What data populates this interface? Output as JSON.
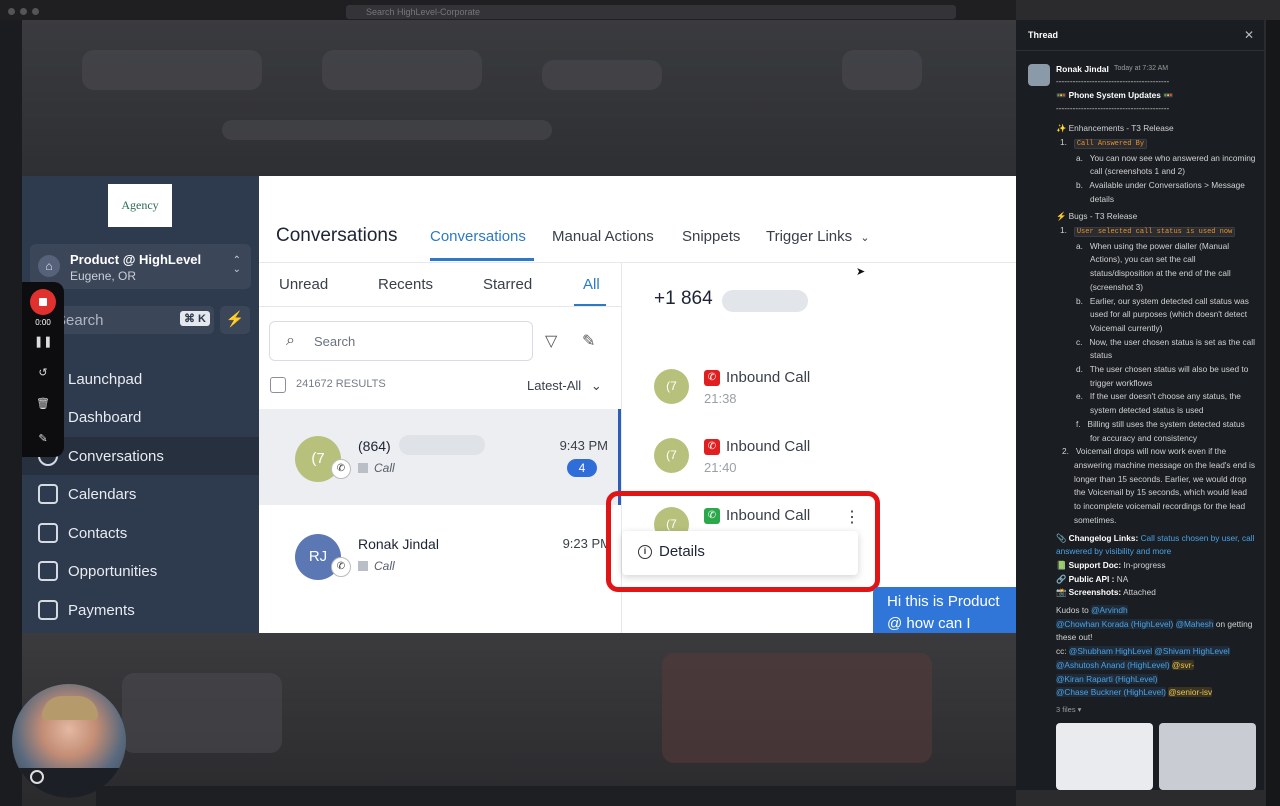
{
  "browser": {
    "search_placeholder": "Search HighLevel-Corporate"
  },
  "logo_text": "Agency",
  "account": {
    "name": "Product @ HighLevel",
    "location": "Eugene, OR"
  },
  "sidebar": {
    "search_placeholder": "Search",
    "shortcut": "⌘ K",
    "items": [
      {
        "label": "Launchpad",
        "icon": "rocket-icon"
      },
      {
        "label": "Dashboard",
        "icon": "grid-icon"
      },
      {
        "label": "Conversations",
        "icon": "chat-icon"
      },
      {
        "label": "Calendars",
        "icon": "calendar-icon"
      },
      {
        "label": "Contacts",
        "icon": "contact-icon"
      },
      {
        "label": "Opportunities",
        "icon": "funnel-icon"
      },
      {
        "label": "Payments",
        "icon": "payment-icon"
      }
    ]
  },
  "recorder": {
    "time": "0:00"
  },
  "header": {
    "title": "Conversations",
    "tabs": [
      "Conversations",
      "Manual Actions",
      "Snippets",
      "Trigger Links"
    ]
  },
  "list": {
    "sub_tabs": [
      "Unread",
      "Recents",
      "Starred",
      "All"
    ],
    "search_placeholder": "Search",
    "results": "241672 RESULTS",
    "sort": "Latest-All",
    "rows": [
      {
        "initials": "(7",
        "name": "(864)",
        "type": "Call",
        "time": "9:43 PM",
        "count": "4",
        "color": "#b8c17c"
      },
      {
        "initials": "RJ",
        "name": "Ronak Jindal",
        "type": "Call",
        "time": "9:23 PM",
        "color": "#5b78b5"
      }
    ]
  },
  "chat": {
    "phone": "+1 864",
    "calls": [
      {
        "initials": "(7",
        "label": "Inbound Call",
        "time": "21:38",
        "color": "#e02020"
      },
      {
        "initials": "(7",
        "label": "Inbound Call",
        "time": "21:40",
        "color": "#e02020"
      },
      {
        "initials": "(7",
        "label": "Inbound Call",
        "time": "",
        "color": "#2aa84a"
      }
    ],
    "menu_item": "Details",
    "bubble": "Hi this is Product @ how can I help?"
  },
  "thread": {
    "title": "Thread",
    "author": "Ronak Jindal",
    "time": "Today at 7:32 AM",
    "divider": "-----------------------------------------",
    "heading": "🚥 Phone System Updates 🚥",
    "enh_title": "✨ Enhancements - T3 Release",
    "enh_1": "Call Answered By",
    "enh_1a": "You can now see who answered an incoming call (screenshots 1 and 2)",
    "enh_1b": "Available under Conversations > Message details",
    "bugs_title": "⚡ Bugs - T3 Release",
    "bug_1": "User selected call status is used now",
    "bug_1a": "When using the power dialler (Manual Actions), you can set the call status/disposition at the end of the call (screenshot 3)",
    "bug_1b": "Earlier, our system detected call status was used for all purposes (which doesn't detect Voicemail currently)",
    "bug_1c": "Now, the user chosen status is set as the call status",
    "bug_1d": "The user chosen status will also be used to trigger workflows",
    "bug_1e": "If the user doesn't choose any status, the system detected status is used",
    "bug_1f": "Billing still uses the system detected status for accuracy and consistency",
    "bug_2": "Voicemail drops will now work even if the answering machine message on the lead's end is longer than 15 seconds. Earlier, we would drop the Voicemail by 15 seconds, which would lead to incomplete voicemail recordings for the lead sometimes.",
    "changelog_label": "📎 Changelog Links:",
    "changelog_link": "Call status chosen by user, call answered by visibility and more",
    "support_label": "📗 Support Doc:",
    "support_val": "In-progress",
    "api_label": "🔗 Public API :",
    "api_val": "NA",
    "shots_label": "📸 Screenshots:",
    "shots_val": "Attached",
    "kudos": "Kudos to",
    "m_arvindh": "@Arvindh",
    "m_chowhan": "@Chowhan Korada (HighLevel)",
    "m_mahesh": "@Mahesh",
    "kudos_tail": "on getting these out!",
    "cc": "cc:",
    "m_shubham": "@Shubham HighLevel",
    "m_shivam": "@Shivam HighLevel",
    "m_ashutosh": "@Ashutosh Anand (HighLevel)",
    "m_svr": "@svr-",
    "m_kiran": "@Kiran Raparti (HighLevel)",
    "m_chase": "@Chase Buckner (HighLevel)",
    "m_senior": "@senior-isv",
    "files": "3 files ▾"
  }
}
